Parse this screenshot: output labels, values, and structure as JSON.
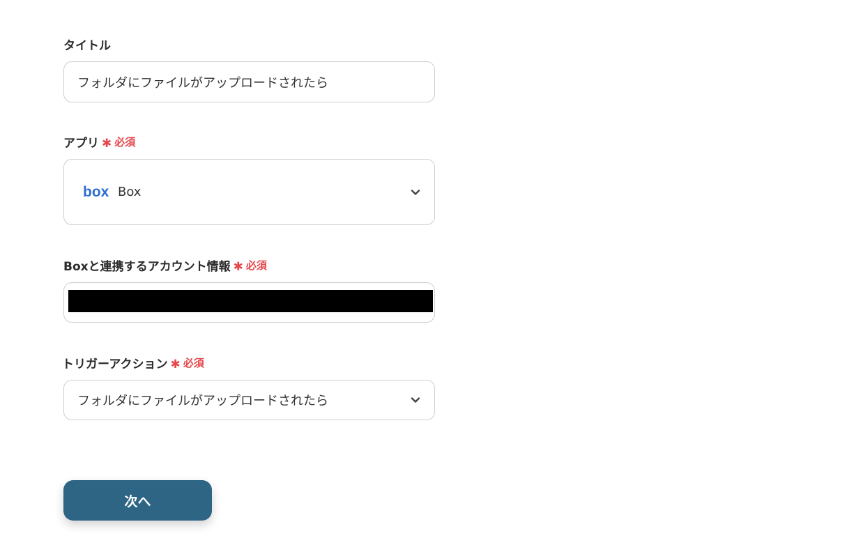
{
  "form": {
    "title_field": {
      "label": "タイトル",
      "value": "フォルダにファイルがアップロードされたら"
    },
    "app_field": {
      "label": "アプリ",
      "required_label": "必須",
      "selected_app": "Box",
      "icon": "box-logo-icon",
      "logo_text": "box",
      "logo_color": "#2f6fd1"
    },
    "account_field": {
      "label": "Boxと連携するアカウント情報",
      "required_label": "必須"
    },
    "trigger_field": {
      "label": "トリガーアクション",
      "required_label": "必須",
      "selected_value": "フォルダにファイルがアップロードされたら"
    }
  },
  "next_button": {
    "label": "次へ",
    "color": "#2e6585"
  },
  "colors": {
    "required": "#e5484d",
    "border": "#cfcfcf"
  }
}
